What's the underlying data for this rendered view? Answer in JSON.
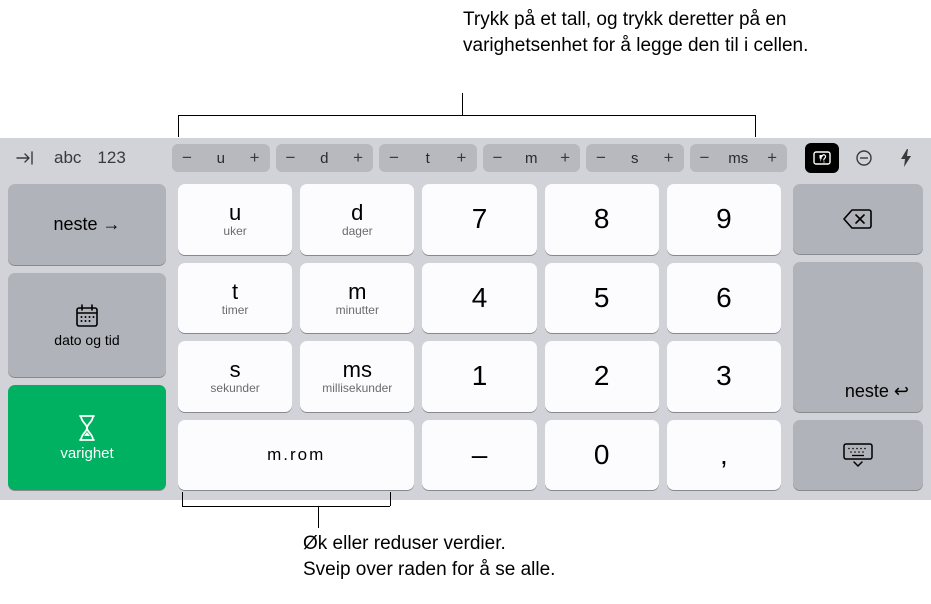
{
  "callouts": {
    "top": "Trykk på et tall, og trykk deretter på en varighetsenhet for å legge den til i cellen.",
    "bottom_line1": "Øk eller reduser verdier.",
    "bottom_line2": "Sveip over raden for å se alle."
  },
  "accessory": {
    "abc": "abc",
    "num": "123",
    "steppers": [
      {
        "label": "u"
      },
      {
        "label": "d"
      },
      {
        "label": "t"
      },
      {
        "label": "m"
      },
      {
        "label": "s"
      },
      {
        "label": "ms"
      }
    ],
    "undo": "↶",
    "lightning": "⚡︎",
    "minus": "−",
    "plus": "+"
  },
  "left": {
    "neste": "neste →",
    "datetime_label": "dato og tid",
    "duration_label": "varighet"
  },
  "units": {
    "u": {
      "main": "u",
      "sub": "uker"
    },
    "d": {
      "main": "d",
      "sub": "dager"
    },
    "t": {
      "main": "t",
      "sub": "timer"
    },
    "m": {
      "main": "m",
      "sub": "minutter"
    },
    "s": {
      "main": "s",
      "sub": "sekunder"
    },
    "ms": {
      "main": "ms",
      "sub": "millisekunder"
    }
  },
  "digits": {
    "7": "7",
    "8": "8",
    "9": "9",
    "4": "4",
    "5": "5",
    "6": "6",
    "1": "1",
    "2": "2",
    "3": "3",
    "0": "0",
    "minus": "–",
    "comma": ","
  },
  "space": "m.rom",
  "right": {
    "neste": "neste ↩︎"
  }
}
